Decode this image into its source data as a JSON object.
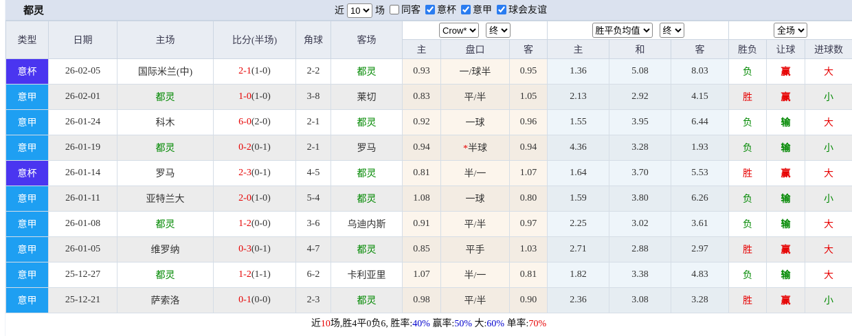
{
  "team_name": "都灵",
  "topbar": {
    "title": "都灵",
    "recent_prefix": "近",
    "recent_count": "10",
    "recent_suffix": "场",
    "filters": [
      {
        "label": "同客",
        "checked": false
      },
      {
        "label": "意杯",
        "checked": true
      },
      {
        "label": "意甲",
        "checked": true
      },
      {
        "label": "球会友谊",
        "checked": true
      }
    ]
  },
  "controls": {
    "odds_company": "Crow*",
    "odds_stage": "终",
    "avg_type": "胜平负均值",
    "avg_stage": "终",
    "scope": "全场"
  },
  "columns": {
    "type": "类型",
    "date": "日期",
    "home": "主场",
    "score": "比分(半场)",
    "corners": "角球",
    "away": "客场",
    "odds_home": "主",
    "odds_handicap": "盘口",
    "odds_away": "客",
    "avg_home": "主",
    "avg_draw": "和",
    "avg_away": "客",
    "result": "胜负",
    "handicap_result": "让球",
    "goals": "进球数"
  },
  "matches": [
    {
      "type": "意杯",
      "date": "26-02-05",
      "home": "国际米兰(中)",
      "score": "2-1",
      "half": "1-0",
      "corners": "2-2",
      "away": "都灵",
      "odds_home": "0.93",
      "handicap": "一/球半",
      "odds_away": "0.95",
      "avg_home": "1.36",
      "avg_draw": "5.08",
      "avg_away": "8.03",
      "result": "负",
      "handicap_result": "赢",
      "goals": "大"
    },
    {
      "type": "意甲",
      "date": "26-02-01",
      "home": "都灵",
      "score": "1-0",
      "half": "1-0",
      "corners": "3-8",
      "away": "莱切",
      "odds_home": "0.83",
      "handicap": "平/半",
      "odds_away": "1.05",
      "avg_home": "2.13",
      "avg_draw": "2.92",
      "avg_away": "4.15",
      "result": "胜",
      "handicap_result": "赢",
      "goals": "小"
    },
    {
      "type": "意甲",
      "date": "26-01-24",
      "home": "科木",
      "score": "6-0",
      "half": "2-0",
      "corners": "2-1",
      "away": "都灵",
      "odds_home": "0.92",
      "handicap": "一球",
      "odds_away": "0.96",
      "avg_home": "1.55",
      "avg_draw": "3.95",
      "avg_away": "6.44",
      "result": "负",
      "handicap_result": "输",
      "goals": "大"
    },
    {
      "type": "意甲",
      "date": "26-01-19",
      "home": "都灵",
      "score": "0-2",
      "half": "0-1",
      "corners": "2-1",
      "away": "罗马",
      "odds_home": "0.94",
      "handicap": "*半球",
      "odds_away": "0.94",
      "avg_home": "4.36",
      "avg_draw": "3.28",
      "avg_away": "1.93",
      "result": "负",
      "handicap_result": "输",
      "goals": "小"
    },
    {
      "type": "意杯",
      "date": "26-01-14",
      "home": "罗马",
      "score": "2-3",
      "half": "0-1",
      "corners": "4-5",
      "away": "都灵",
      "odds_home": "0.81",
      "handicap": "半/一",
      "odds_away": "1.07",
      "avg_home": "1.64",
      "avg_draw": "3.70",
      "avg_away": "5.53",
      "result": "胜",
      "handicap_result": "赢",
      "goals": "大"
    },
    {
      "type": "意甲",
      "date": "26-01-11",
      "home": "亚特兰大",
      "score": "2-0",
      "half": "1-0",
      "corners": "5-4",
      "away": "都灵",
      "odds_home": "1.08",
      "handicap": "一球",
      "odds_away": "0.80",
      "avg_home": "1.59",
      "avg_draw": "3.80",
      "avg_away": "6.26",
      "result": "负",
      "handicap_result": "输",
      "goals": "小"
    },
    {
      "type": "意甲",
      "date": "26-01-08",
      "home": "都灵",
      "score": "1-2",
      "half": "0-0",
      "corners": "3-6",
      "away": "乌迪内斯",
      "odds_home": "0.91",
      "handicap": "平/半",
      "odds_away": "0.97",
      "avg_home": "2.25",
      "avg_draw": "3.02",
      "avg_away": "3.61",
      "result": "负",
      "handicap_result": "输",
      "goals": "大"
    },
    {
      "type": "意甲",
      "date": "26-01-05",
      "home": "维罗纳",
      "score": "0-3",
      "half": "0-1",
      "corners": "4-7",
      "away": "都灵",
      "odds_home": "0.85",
      "handicap": "平手",
      "odds_away": "1.03",
      "avg_home": "2.71",
      "avg_draw": "2.88",
      "avg_away": "2.97",
      "result": "胜",
      "handicap_result": "赢",
      "goals": "大"
    },
    {
      "type": "意甲",
      "date": "25-12-27",
      "home": "都灵",
      "score": "1-2",
      "half": "1-1",
      "corners": "6-2",
      "away": "卡利亚里",
      "odds_home": "1.07",
      "handicap": "半/一",
      "odds_away": "0.81",
      "avg_home": "1.82",
      "avg_draw": "3.38",
      "avg_away": "4.83",
      "result": "负",
      "handicap_result": "输",
      "goals": "大"
    },
    {
      "type": "意甲",
      "date": "25-12-21",
      "home": "萨索洛",
      "score": "0-1",
      "half": "0-0",
      "corners": "2-3",
      "away": "都灵",
      "odds_home": "0.98",
      "handicap": "平/半",
      "odds_away": "0.90",
      "avg_home": "2.36",
      "avg_draw": "3.08",
      "avg_away": "3.28",
      "result": "胜",
      "handicap_result": "赢",
      "goals": "小"
    }
  ],
  "footer": {
    "segments": [
      {
        "text": "近"
      },
      {
        "text": "10",
        "color": "red"
      },
      {
        "text": "场,胜4平0负6, 胜率:"
      },
      {
        "text": "40%",
        "color": "blue"
      },
      {
        "text": " 赢率:"
      },
      {
        "text": "50%",
        "color": "blue"
      },
      {
        "text": " 大:"
      },
      {
        "text": "60%",
        "color": "blue"
      },
      {
        "text": " 单率:"
      },
      {
        "text": "70%",
        "color": "red"
      }
    ]
  },
  "colors": {
    "serie_a_badge": "#1e9ff2",
    "cup_badge": "#4a35f0",
    "win_red": "#e60000",
    "lose_green": "#008800",
    "rate_blue": "#0000cc",
    "topbar_bg": "#dbe2ef"
  }
}
